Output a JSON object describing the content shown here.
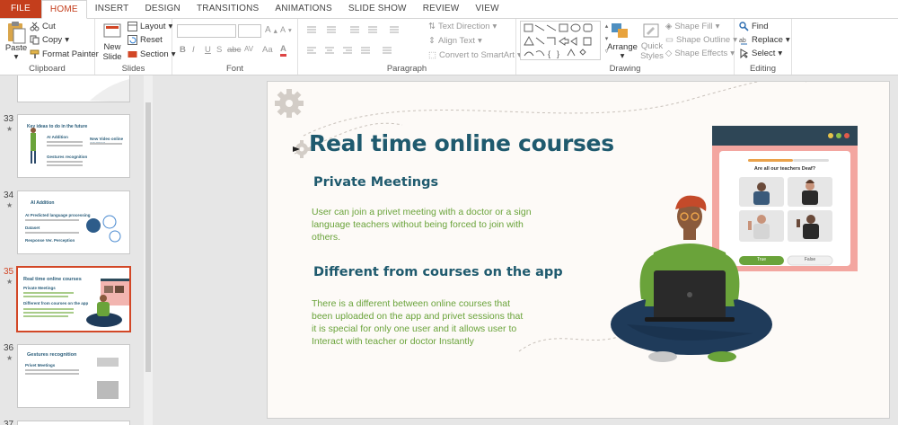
{
  "tabs": [
    "FILE",
    "HOME",
    "INSERT",
    "DESIGN",
    "TRANSITIONS",
    "ANIMATIONS",
    "SLIDE SHOW",
    "REVIEW",
    "VIEW"
  ],
  "ribbon": {
    "clipboard": {
      "paste": "Paste",
      "cut": "Cut",
      "copy": "Copy",
      "format_painter": "Format Painter",
      "label": "Clipboard"
    },
    "slides": {
      "new_slide": "New Slide",
      "layout": "Layout",
      "reset": "Reset",
      "section": "Section",
      "label": "Slides"
    },
    "font": {
      "label": "Font",
      "bold": "B",
      "italic": "I",
      "underline": "U",
      "strike": "S",
      "abc": "abc",
      "av": "AV",
      "aa": "Aa",
      "font_color": "A"
    },
    "paragraph": {
      "text_direction": "Text Direction",
      "align_text": "Align Text",
      "convert_smartart": "Convert to SmartArt",
      "label": "Paragraph"
    },
    "drawing": {
      "arrange": "Arrange",
      "quick_styles": "Quick Styles",
      "shape_fill": "Shape Fill",
      "shape_outline": "Shape Outline",
      "shape_effects": "Shape Effects",
      "label": "Drawing"
    },
    "editing": {
      "find": "Find",
      "replace": "Replace",
      "select": "Select",
      "label": "Editing"
    }
  },
  "thumbnails": [
    {
      "num": "33",
      "title": "Key ideas to do in the future",
      "items": [
        "AI Addition",
        "New Video online courses",
        "Gestures recognition"
      ]
    },
    {
      "num": "34",
      "title": "AI Addition",
      "items": [
        "AI Predicted language processing",
        "Dataset",
        "Response Ver. Perception"
      ]
    },
    {
      "num": "35",
      "title": "Real time online courses",
      "items": [
        "Private Meetings",
        "Different from courses on the app"
      ]
    },
    {
      "num": "36",
      "title": "Gestures recognition",
      "items": [
        "Privet Meetings"
      ]
    },
    {
      "num": "37"
    }
  ],
  "slide": {
    "title": "Real time online courses",
    "heading1": "Private Meetings",
    "para1": "User can join a privet meeting with a doctor or a sign language teachers without being forced to join with others.",
    "heading2": "Different from courses on the app",
    "para2": "There is a different between online courses that been uploaded on  the app and privet sessions that it is special for only one user and it allows user to Interact with teacher or doctor Instantly",
    "screen_question": "Are all our teachers Deaf?",
    "screen_true": "True",
    "screen_false": "False"
  },
  "colors": {
    "accent": "#c43e1c",
    "title": "#1f5a6e",
    "body": "#6aa33a",
    "selected": "#d24726"
  },
  "status_text": "...",
  "icons": [
    "paste-icon",
    "cut-icon",
    "copy-icon",
    "format-painter-icon",
    "new-slide-icon",
    "layout-icon",
    "reset-icon",
    "section-icon",
    "find-icon",
    "replace-icon",
    "select-icon",
    "gear-icon"
  ]
}
